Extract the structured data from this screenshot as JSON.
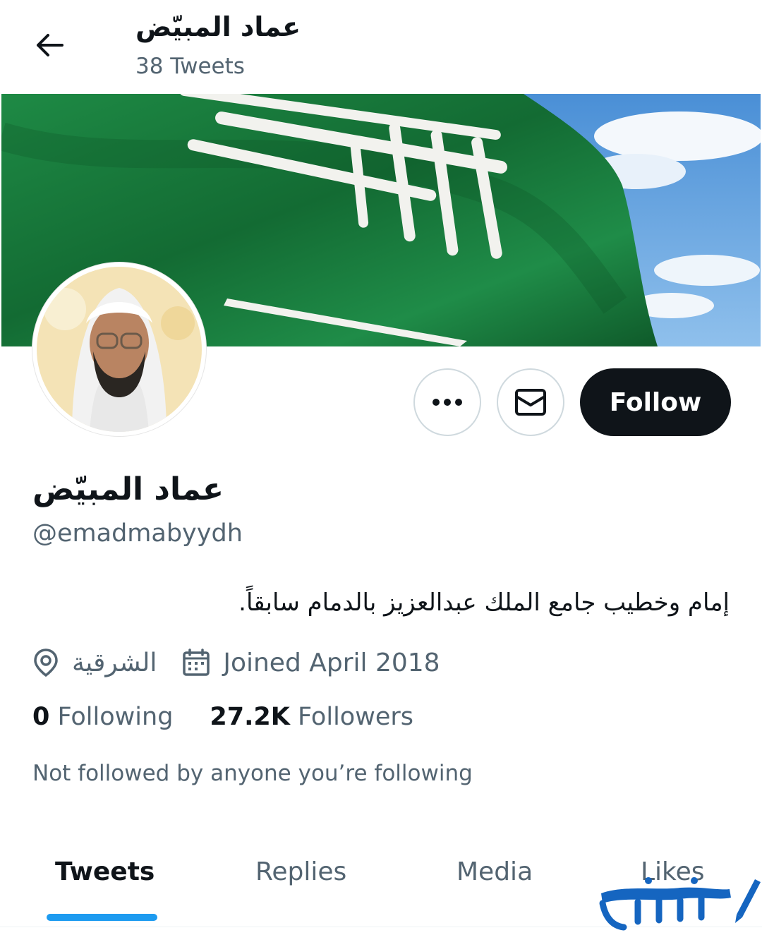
{
  "header": {
    "title": "عماد المبيّض",
    "subtitle": "38 Tweets"
  },
  "profile": {
    "display_name": "عماد المبيّض",
    "handle": "@emadmabyydh",
    "bio": "إمام وخطيب جامع الملك عبدالعزيز بالدمام سابقاً.",
    "location": "الشرقية",
    "joined": "Joined April 2018",
    "following_count": "0",
    "following_label": "Following",
    "followers_count": "27.2K",
    "followers_label": "Followers",
    "social_context": "Not followed by anyone you’re following"
  },
  "actions": {
    "follow_label": "Follow",
    "more_icon": "more-horizontal-icon",
    "message_icon": "envelope-icon"
  },
  "tabs": [
    {
      "label": "Tweets",
      "active": true
    },
    {
      "label": "Replies",
      "active": false
    },
    {
      "label": "Media",
      "active": false
    },
    {
      "label": "Likes",
      "active": false
    }
  ],
  "banner": {
    "text": "لا إله إلا الله محمد رسول الله"
  },
  "watermark": {
    "text": "محتوى"
  },
  "colors": {
    "accent": "#1d9bf0",
    "text_primary": "#0f1419",
    "text_secondary": "#536471",
    "flag_green": "#1f7a3c",
    "watermark_blue": "#1565c0"
  }
}
